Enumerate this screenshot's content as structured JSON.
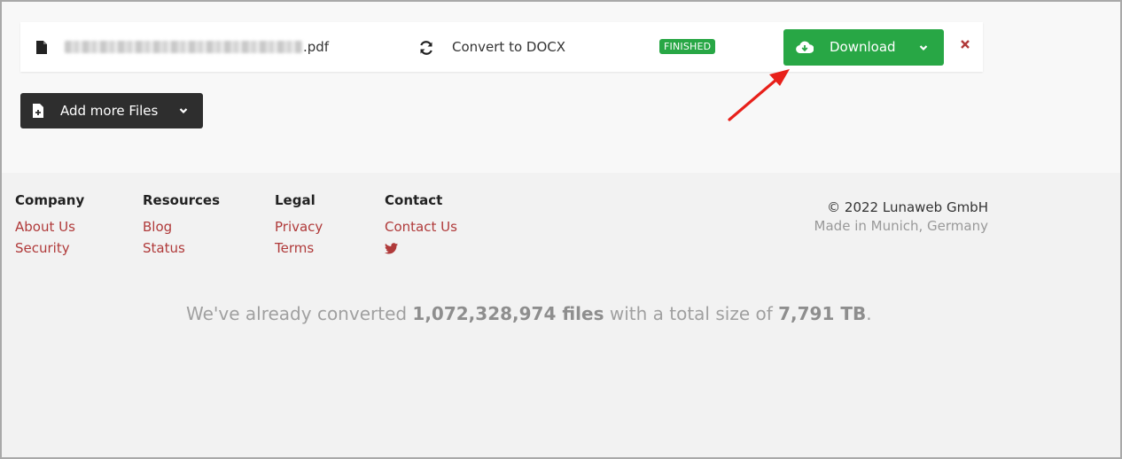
{
  "file": {
    "name_suffix": ".pdf",
    "convert_label": "Convert to DOCX",
    "status": "FINISHED",
    "download_label": "Download"
  },
  "add_more": {
    "label": "Add more Files"
  },
  "footer": {
    "columns": [
      {
        "title": "Company",
        "links": [
          "About Us",
          "Security"
        ]
      },
      {
        "title": "Resources",
        "links": [
          "Blog",
          "Status"
        ]
      },
      {
        "title": "Legal",
        "links": [
          "Privacy",
          "Terms"
        ]
      },
      {
        "title": "Contact",
        "links": [
          "Contact Us"
        ]
      }
    ],
    "copyright": "© 2022 Lunaweb GmbH",
    "location": "Made in Munich, Germany"
  },
  "stats": {
    "prefix": "We've already converted ",
    "files_count": "1,072,328,974 files",
    "middle": " with a total size of ",
    "total_size": "7,791 TB",
    "suffix": "."
  },
  "colors": {
    "accent_green": "#28a745",
    "link_red": "#b03a3a",
    "dark_button": "#2e2e2e",
    "annotation_arrow": "#e8201a"
  },
  "icons": {
    "file": "file-icon",
    "convert": "refresh-icon",
    "download": "cloud-download-icon",
    "dropdown": "chevron-down-icon",
    "remove": "close-icon",
    "add_file": "file-plus-icon",
    "twitter": "twitter-icon"
  }
}
